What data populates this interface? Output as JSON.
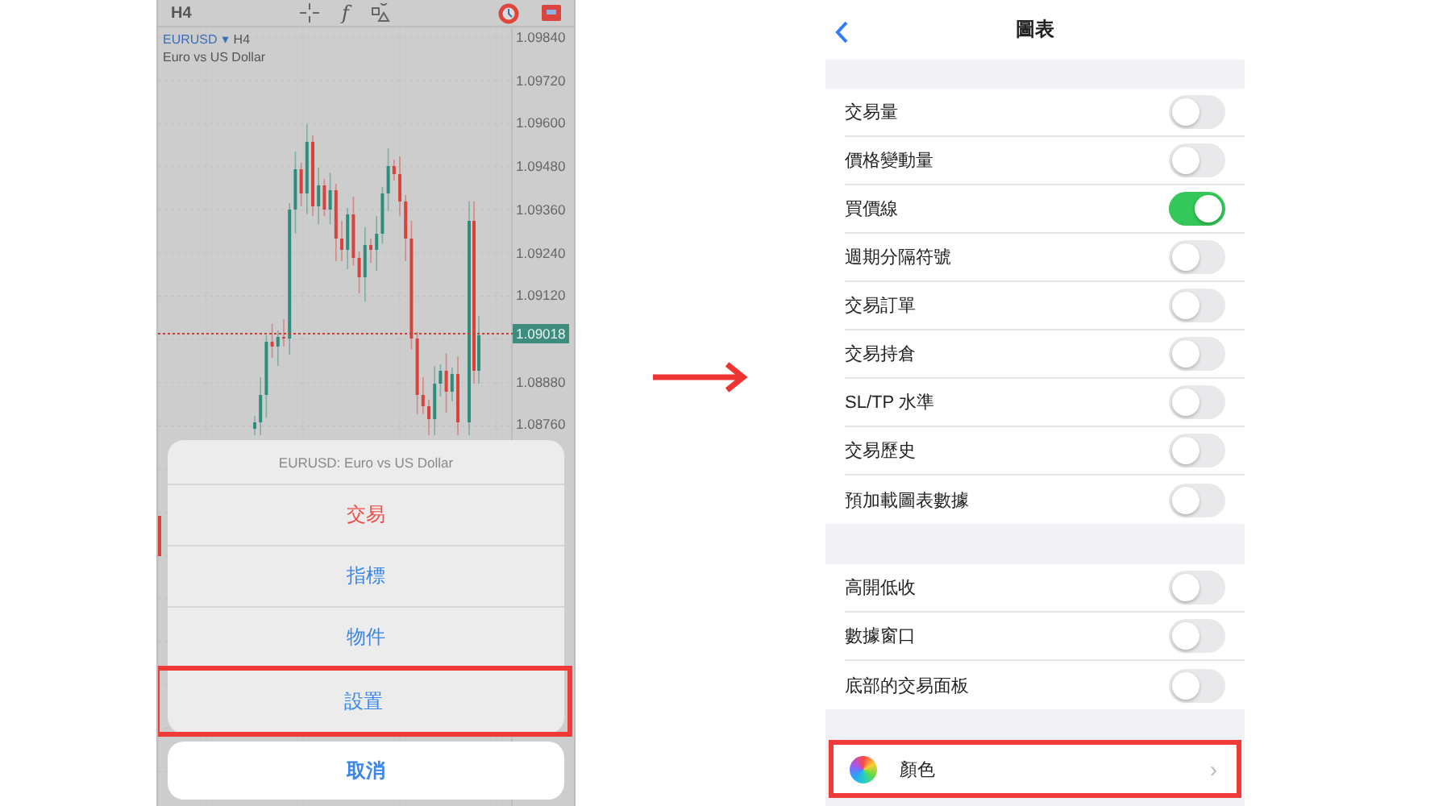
{
  "left_screen": {
    "toolbar": {
      "timeframe": "H4",
      "function_symbol": "f"
    },
    "chart": {
      "symbol": "EURUSD",
      "dropdown_symbol": "▾",
      "timeframe": "H4",
      "description": "Euro vs US Dollar",
      "price_labels": [
        "1.09840",
        "1.09720",
        "1.09600",
        "1.09480",
        "1.09360",
        "1.09240",
        "1.09120",
        "1.08880",
        "1.08760"
      ],
      "current_price": "1.09018"
    },
    "action_sheet": {
      "title": "EURUSD: Euro vs US Dollar",
      "items": [
        {
          "label": "交易",
          "kind": "destructive",
          "highlighted": false
        },
        {
          "label": "指標",
          "kind": "default",
          "highlighted": false
        },
        {
          "label": "物件",
          "kind": "default",
          "highlighted": false
        },
        {
          "label": "設置",
          "kind": "default",
          "highlighted": true
        }
      ],
      "cancel": "取消"
    }
  },
  "right_screen": {
    "nav": {
      "title": "圖表"
    },
    "sections": [
      [
        {
          "label": "交易量",
          "on": false
        },
        {
          "label": "價格變動量",
          "on": false
        },
        {
          "label": "買價線",
          "on": true
        },
        {
          "label": "週期分隔符號",
          "on": false
        },
        {
          "label": "交易訂單",
          "on": false
        },
        {
          "label": "交易持倉",
          "on": false
        },
        {
          "label": "SL/TP 水準",
          "on": false
        },
        {
          "label": "交易歷史",
          "on": false
        },
        {
          "label": "預加載圖表數據",
          "on": false
        }
      ],
      [
        {
          "label": "高開低收",
          "on": false
        },
        {
          "label": "數據窗口",
          "on": false
        },
        {
          "label": "底部的交易面板",
          "on": false
        }
      ]
    ],
    "color_row": {
      "label": "顏色",
      "highlighted": true,
      "chevron": "›"
    }
  }
}
